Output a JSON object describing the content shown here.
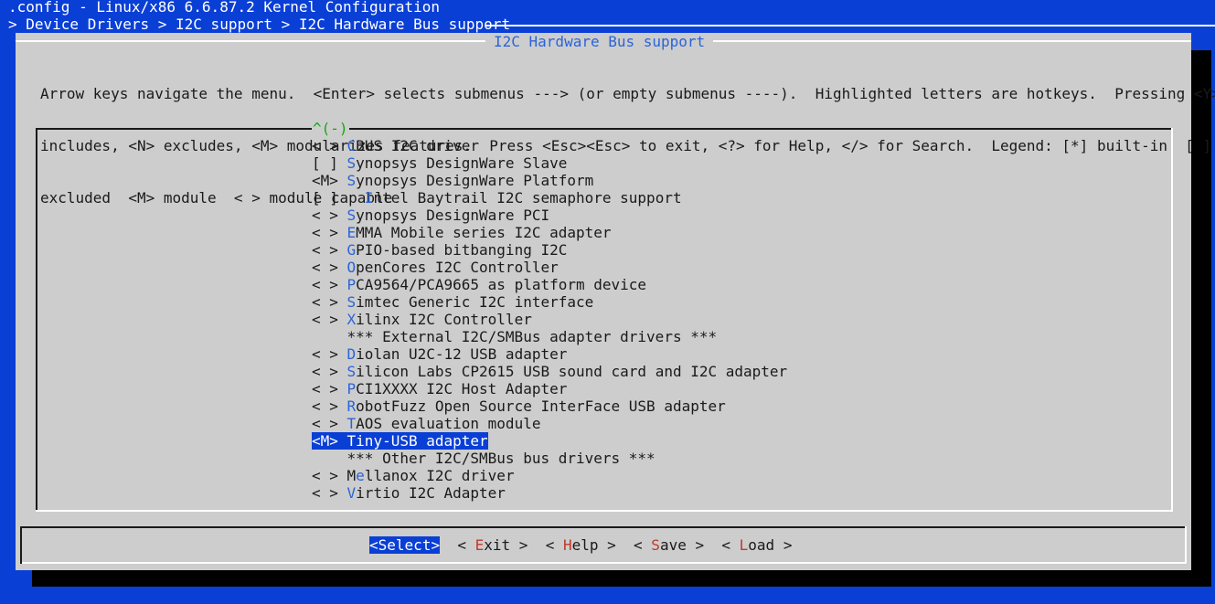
{
  "window": {
    "title": ".config - Linux/x86 6.6.87.2 Kernel Configuration",
    "breadcrumb": "> Device Drivers > I2C support > I2C Hardware Bus support"
  },
  "dialog": {
    "title": "I2C Hardware Bus support",
    "help_lines": [
      "Arrow keys navigate the menu.  <Enter> selects submenus ---> (or empty submenus ----).  Highlighted letters are hotkeys.  Pressing <Y>",
      "includes, <N> excludes, <M> modularizes features.  Press <Esc><Esc> to exit, <?> for Help, </> for Search.  Legend: [*] built-in  [ ]",
      "excluded  <M> module  < > module capable"
    ],
    "scroll_indicator": "^(-)"
  },
  "menu": {
    "items": [
      {
        "prefix": "< > ",
        "hotkey": "C",
        "rest": "BUS I2C driver",
        "selected": false
      },
      {
        "prefix": "[ ] ",
        "hotkey": "S",
        "rest": "ynopsys DesignWare Slave",
        "selected": false
      },
      {
        "prefix": "<M> ",
        "hotkey": "S",
        "rest": "ynopsys DesignWare Platform",
        "selected": false
      },
      {
        "prefix": "[ ]   ",
        "hotkey": "I",
        "rest": "ntel Baytrail I2C semaphore support",
        "selected": false
      },
      {
        "prefix": "< > ",
        "hotkey": "S",
        "rest": "ynopsys DesignWare PCI",
        "selected": false
      },
      {
        "prefix": "< > ",
        "hotkey": "E",
        "rest": "MMA Mobile series I2C adapter",
        "selected": false
      },
      {
        "prefix": "< > ",
        "hotkey": "G",
        "rest": "PIO-based bitbanging I2C",
        "selected": false
      },
      {
        "prefix": "< > ",
        "hotkey": "O",
        "rest": "penCores I2C Controller",
        "selected": false
      },
      {
        "prefix": "< > ",
        "hotkey": "P",
        "rest": "CA9564/PCA9665 as platform device",
        "selected": false
      },
      {
        "prefix": "< > ",
        "hotkey": "S",
        "rest": "imtec Generic I2C interface",
        "selected": false
      },
      {
        "prefix": "< > ",
        "hotkey": "X",
        "rest": "ilinx I2C Controller",
        "selected": false
      },
      {
        "prefix": "    ",
        "hotkey": "",
        "rest": "*** External I2C/SMBus adapter drivers ***",
        "selected": false
      },
      {
        "prefix": "< > ",
        "hotkey": "D",
        "rest": "iolan U2C-12 USB adapter",
        "selected": false
      },
      {
        "prefix": "< > ",
        "hotkey": "S",
        "rest": "ilicon Labs CP2615 USB sound card and I2C adapter",
        "selected": false
      },
      {
        "prefix": "< > ",
        "hotkey": "P",
        "rest": "CI1XXXX I2C Host Adapter",
        "selected": false
      },
      {
        "prefix": "< > ",
        "hotkey": "R",
        "rest": "obotFuzz Open Source InterFace USB adapter",
        "selected": false
      },
      {
        "prefix": "< > ",
        "hotkey": "T",
        "rest": "AOS evaluation module",
        "selected": false
      },
      {
        "prefix": "<M> ",
        "hotkey": "T",
        "rest": "iny-USB adapter",
        "selected": true
      },
      {
        "prefix": "    ",
        "hotkey": "",
        "rest": "*** Other I2C/SMBus bus drivers ***",
        "selected": false
      },
      {
        "prefix": "< > M",
        "hotkey": "e",
        "rest": "llanox I2C driver",
        "selected": false
      },
      {
        "prefix": "< > ",
        "hotkey": "V",
        "rest": "irtio I2C Adapter",
        "selected": false
      }
    ]
  },
  "buttons": [
    {
      "pre": "<",
      "hotkey": "S",
      "rest": "elect>",
      "selected": true
    },
    {
      "pre": "< ",
      "hotkey": "E",
      "rest": "xit >",
      "selected": false
    },
    {
      "pre": "< ",
      "hotkey": "H",
      "rest": "elp >",
      "selected": false
    },
    {
      "pre": "< ",
      "hotkey": "S",
      "rest": "ave >",
      "selected": false
    },
    {
      "pre": "< ",
      "hotkey": "L",
      "rest": "oad >",
      "selected": false
    }
  ],
  "colors": {
    "background": "#0a3fd6",
    "dialog": "#cdcdcd",
    "hotkey": "#2a64d8",
    "button_hotkey": "#c0392b",
    "scroll_indicator": "#14a814"
  }
}
